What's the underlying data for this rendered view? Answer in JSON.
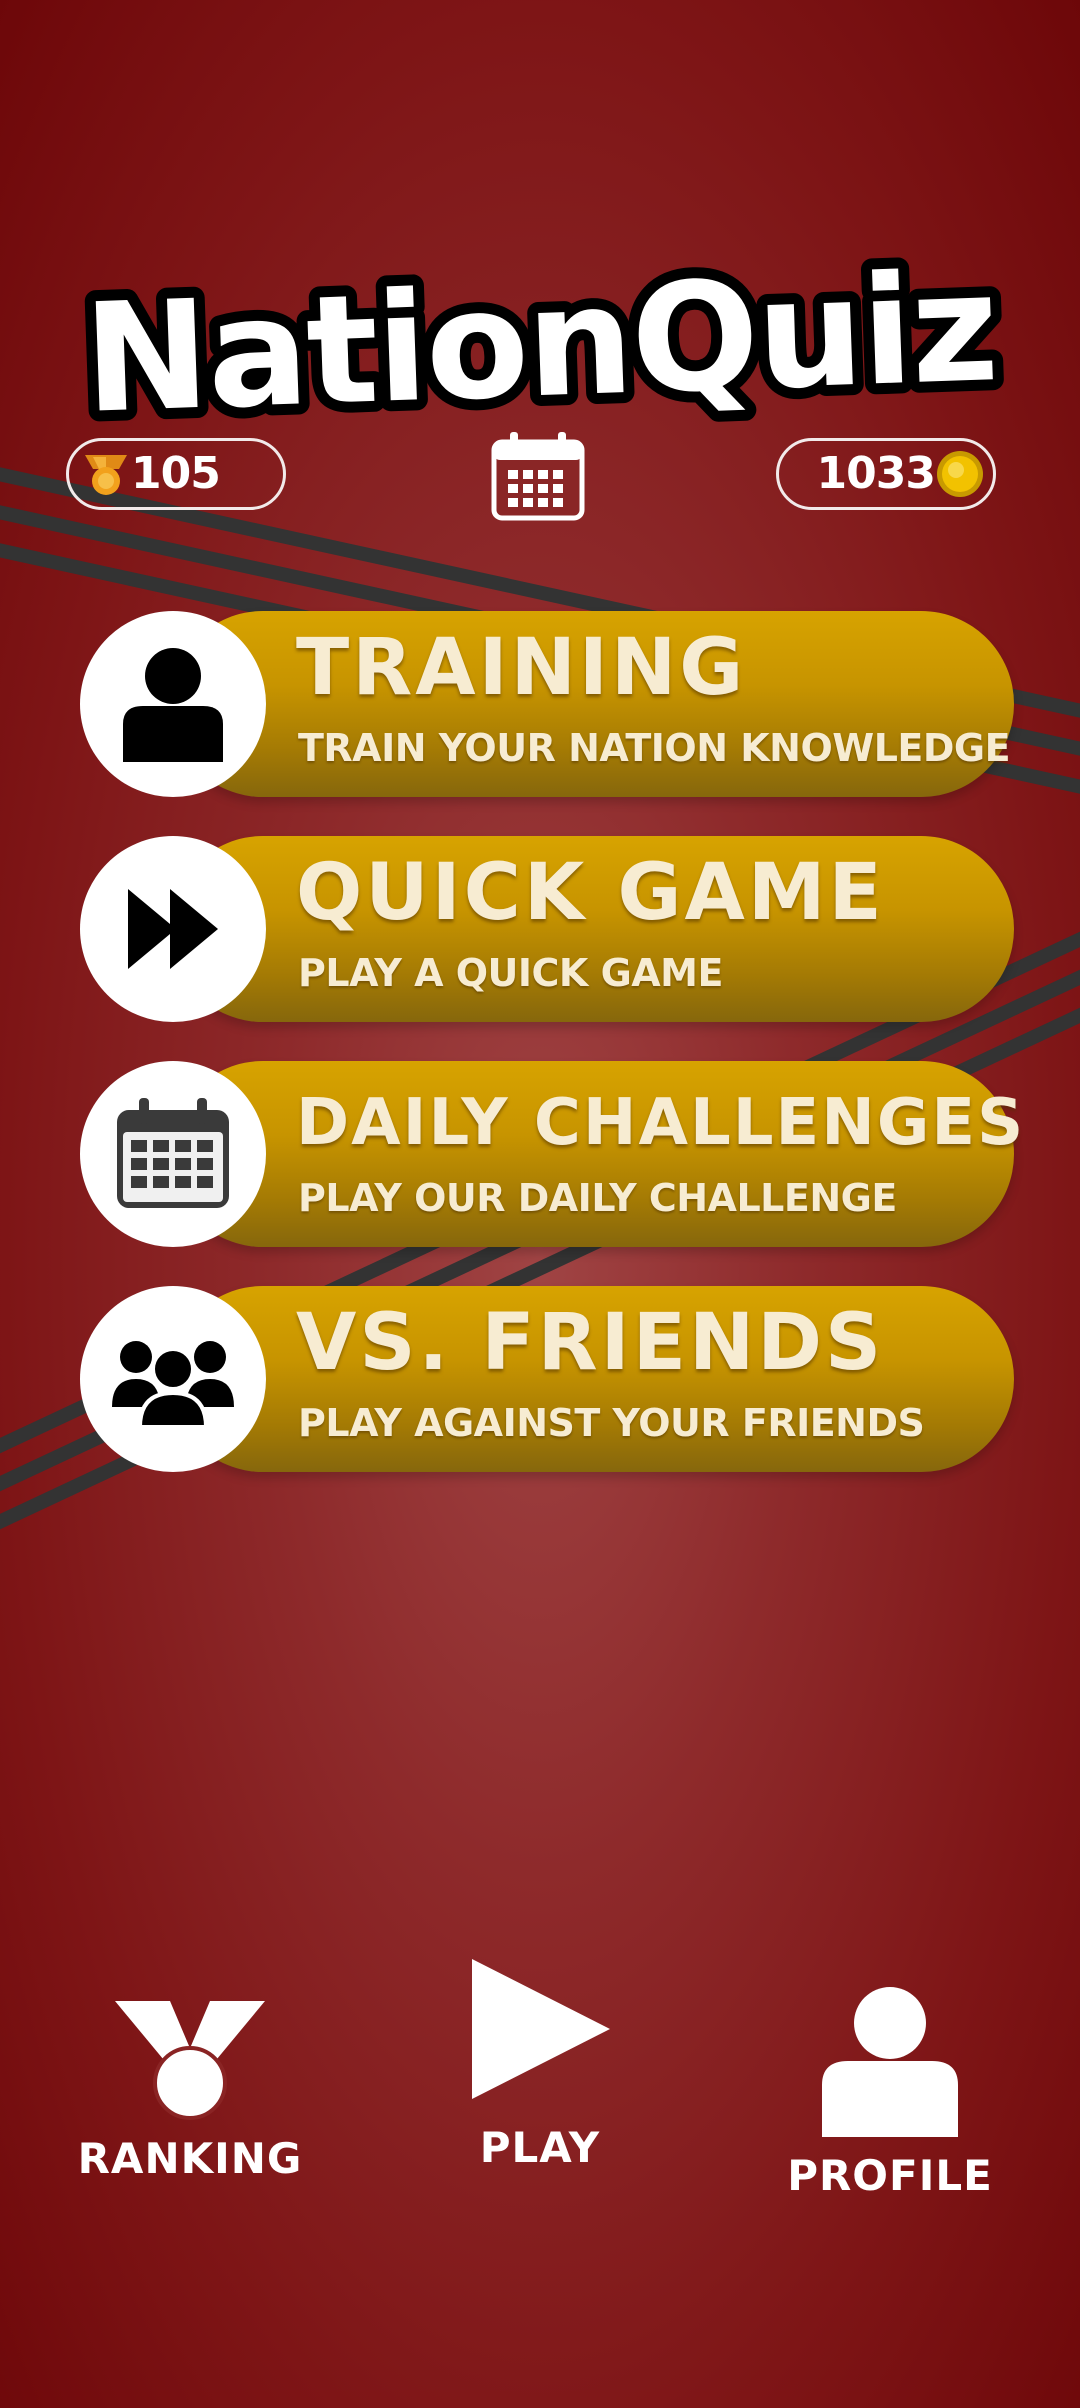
{
  "app": {
    "title": "NationQuiz"
  },
  "colors": {
    "background": "#8e2a2b",
    "menu_gold": "#c79400",
    "text_cream": "#f7ecd2",
    "coin_gold": "#f2c200"
  },
  "header": {
    "medals": {
      "icon": "medal-icon",
      "value": "105"
    },
    "calendar": {
      "icon": "calendar-icon"
    },
    "coins": {
      "value": "1033",
      "icon": "coin-icon"
    }
  },
  "menu": [
    {
      "icon": "person-icon",
      "title": "TRAINING",
      "subtitle": "TRAIN YOUR NATION KNOWLEDGE"
    },
    {
      "icon": "fast-forward-icon",
      "title": "QUICK GAME",
      "subtitle": "PLAY A QUICK GAME"
    },
    {
      "icon": "calendar-icon",
      "title": "DAILY CHALLENGES",
      "subtitle": "PLAY OUR DAILY CHALLENGE"
    },
    {
      "icon": "group-icon",
      "title": "VS. FRIENDS",
      "subtitle": "PLAY AGAINST YOUR FRIENDS"
    }
  ],
  "bottom_nav": [
    {
      "icon": "medal-icon",
      "label": "RANKING"
    },
    {
      "icon": "play-icon",
      "label": "PLAY"
    },
    {
      "icon": "person-icon",
      "label": "PROFILE"
    }
  ]
}
